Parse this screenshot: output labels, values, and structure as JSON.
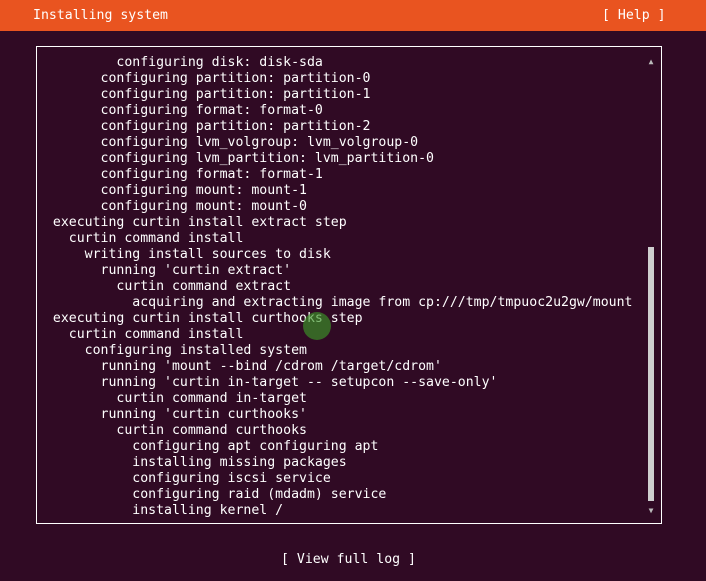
{
  "header": {
    "title": "Installing system",
    "help_label": "[ Help ]",
    "background_color": "#e95420"
  },
  "log": {
    "lines": [
      "          configuring disk: disk-sda",
      "        configuring partition: partition-0",
      "        configuring partition: partition-1",
      "        configuring format: format-0",
      "        configuring partition: partition-2",
      "        configuring lvm_volgroup: lvm_volgroup-0",
      "        configuring lvm_partition: lvm_partition-0",
      "        configuring format: format-1",
      "        configuring mount: mount-1",
      "        configuring mount: mount-0",
      "  executing curtin install extract step",
      "    curtin command install",
      "      writing install sources to disk",
      "        running 'curtin extract'",
      "          curtin command extract",
      "            acquiring and extracting image from cp:///tmp/tmpuoc2u2gw/mount",
      "  executing curtin install curthooks step",
      "    curtin command install",
      "      configuring installed system",
      "        running 'mount --bind /cdrom /target/cdrom'",
      "        running 'curtin in-target -- setupcon --save-only'",
      "          curtin command in-target",
      "        running 'curtin curthooks'",
      "          curtin command curthooks",
      "            configuring apt configuring apt",
      "            installing missing packages",
      "            configuring iscsi service",
      "            configuring raid (mdadm) service",
      "            installing kernel /"
    ]
  },
  "scrollbar": {
    "up_icon": "▲",
    "down_icon": "▼"
  },
  "footer": {
    "view_log_label": "[ View full log ]"
  },
  "colors": {
    "background": "#300a24",
    "accent": "#e95420",
    "text": "#ffffff"
  }
}
